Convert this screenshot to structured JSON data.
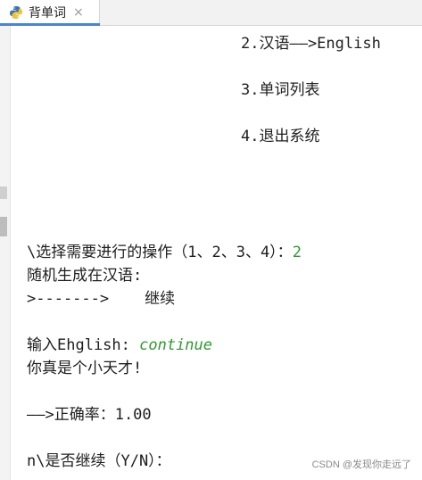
{
  "tab": {
    "title": "背单词",
    "close_glyph": "×",
    "icon": "python-icon"
  },
  "menu": {
    "item2": "2.汉语——>English",
    "item3": "3.单词列表",
    "item4": "4.退出系统"
  },
  "output": {
    "prompt": "\\选择需要进行的操作（1、2、3、4）：",
    "choice": "2",
    "random_label": "随机生成在汉语:",
    "arrow_prefix": ">------->",
    "word": "继续",
    "input_label": "输入Ehglish: ",
    "input_value": "continue",
    "praise": "你真是个小天才!",
    "accuracy": "——>正确率：1.00",
    "continue_prompt": "n\\是否继续（Y/N）："
  },
  "watermark": "CSDN @发现你走远了",
  "colors": {
    "input_green": "#2f9a2f",
    "tab_accent": "#4a86c8"
  }
}
